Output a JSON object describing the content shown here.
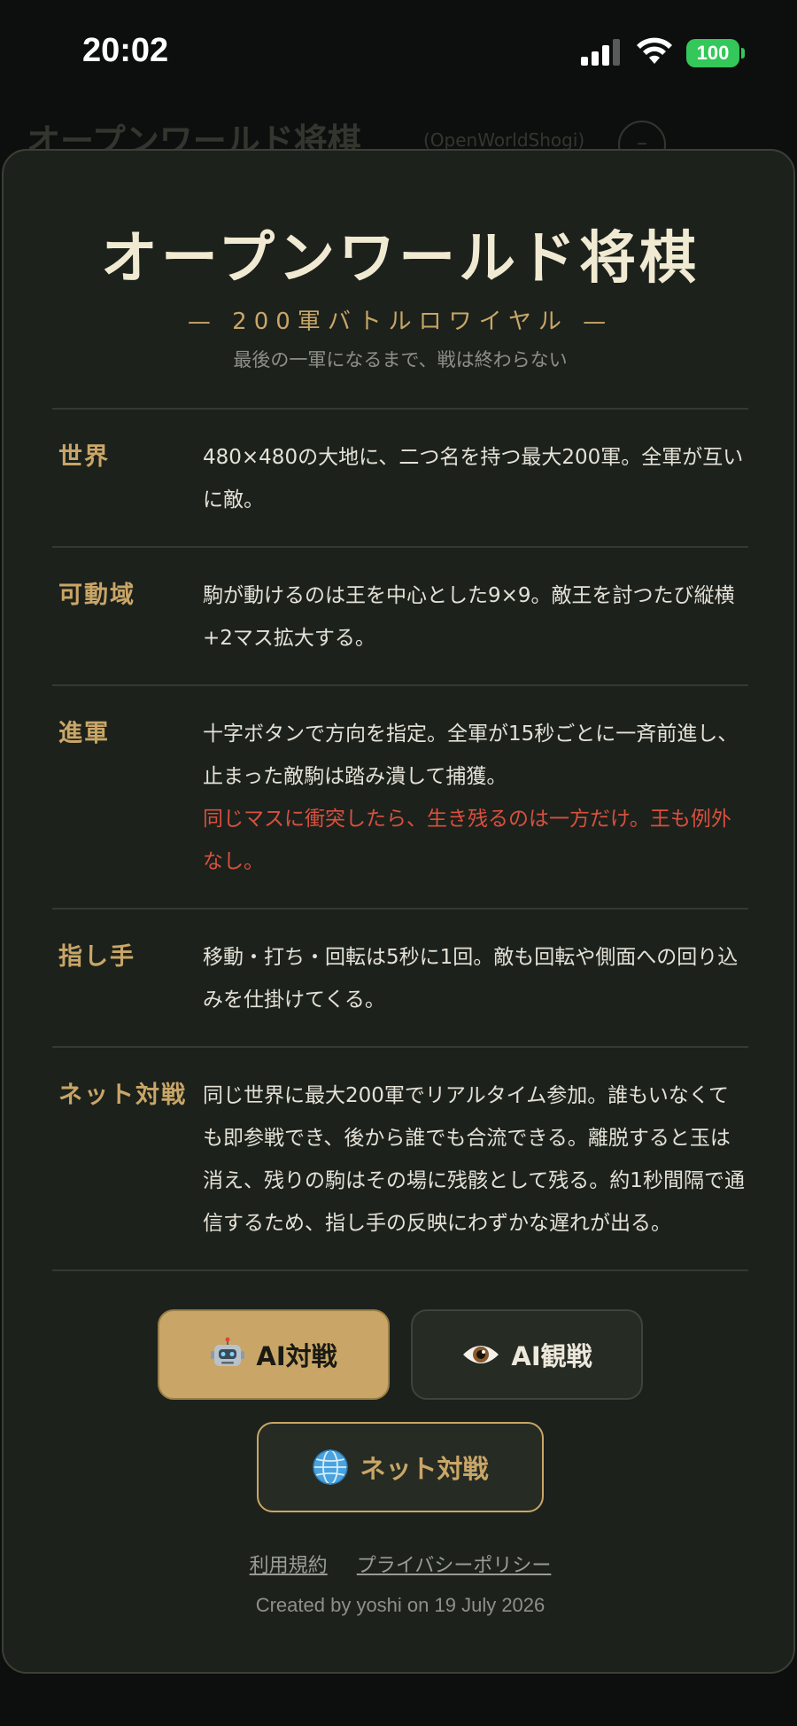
{
  "status_bar": {
    "time": "20:02",
    "battery": "100"
  },
  "background": {
    "title": "オープンワールド将棋",
    "subtitle": "(OpenWorldShogi)"
  },
  "modal": {
    "title": "オープンワールド将棋",
    "tagline": "— 200軍バトルロワイヤル —",
    "subtitle": "最後の一軍になるまで、戦は終わらない",
    "rules": [
      {
        "label": "世界",
        "lines": [
          "480×480の大地に、二つ名を持つ最大200軍。全軍が互いに敵。"
        ]
      },
      {
        "label": "可動域",
        "lines": [
          "駒が動けるのは王を中心とした9×9。敵王を討つたび縦横+2マス拡大する。"
        ]
      },
      {
        "label": "進軍",
        "lines": [
          "十字ボタンで方向を指定。全軍が15秒ごとに一斉前進し、止まった敵駒は踏み潰して捕獲。"
        ],
        "warning": "同じマスに衝突したら、生き残るのは一方だけ。王も例外なし。"
      },
      {
        "label": "指し手",
        "lines": [
          "移動・打ち・回転は5秒に1回。敵も回転や側面への回り込みを仕掛けてくる。"
        ]
      },
      {
        "label": "ネット対戦",
        "lines": [
          "同じ世界に最大200軍でリアルタイム参加。誰もいなくても即参戦でき、後から誰でも合流できる。離脱すると玉は消え、残りの駒はその場に残骸として残る。約1秒間隔で通信するため、指し手の反映にわずかな遅れが出る。"
        ]
      }
    ],
    "buttons": {
      "ai_battle": "AI対戦",
      "ai_watch": "AI観戦",
      "net_battle": "ネット対戦"
    },
    "footer": {
      "terms": "利用規約",
      "privacy": "プライバシーポリシー",
      "credit": "Created by yoshi on 19 July 2026"
    }
  },
  "colors": {
    "accent_gold": "#c9a667",
    "warning_red": "#d9503e",
    "card_bg": "#1c211c"
  },
  "icons": [
    "signal-icon",
    "wifi-icon",
    "battery-icon",
    "robot-icon",
    "eye-icon",
    "globe-icon"
  ]
}
